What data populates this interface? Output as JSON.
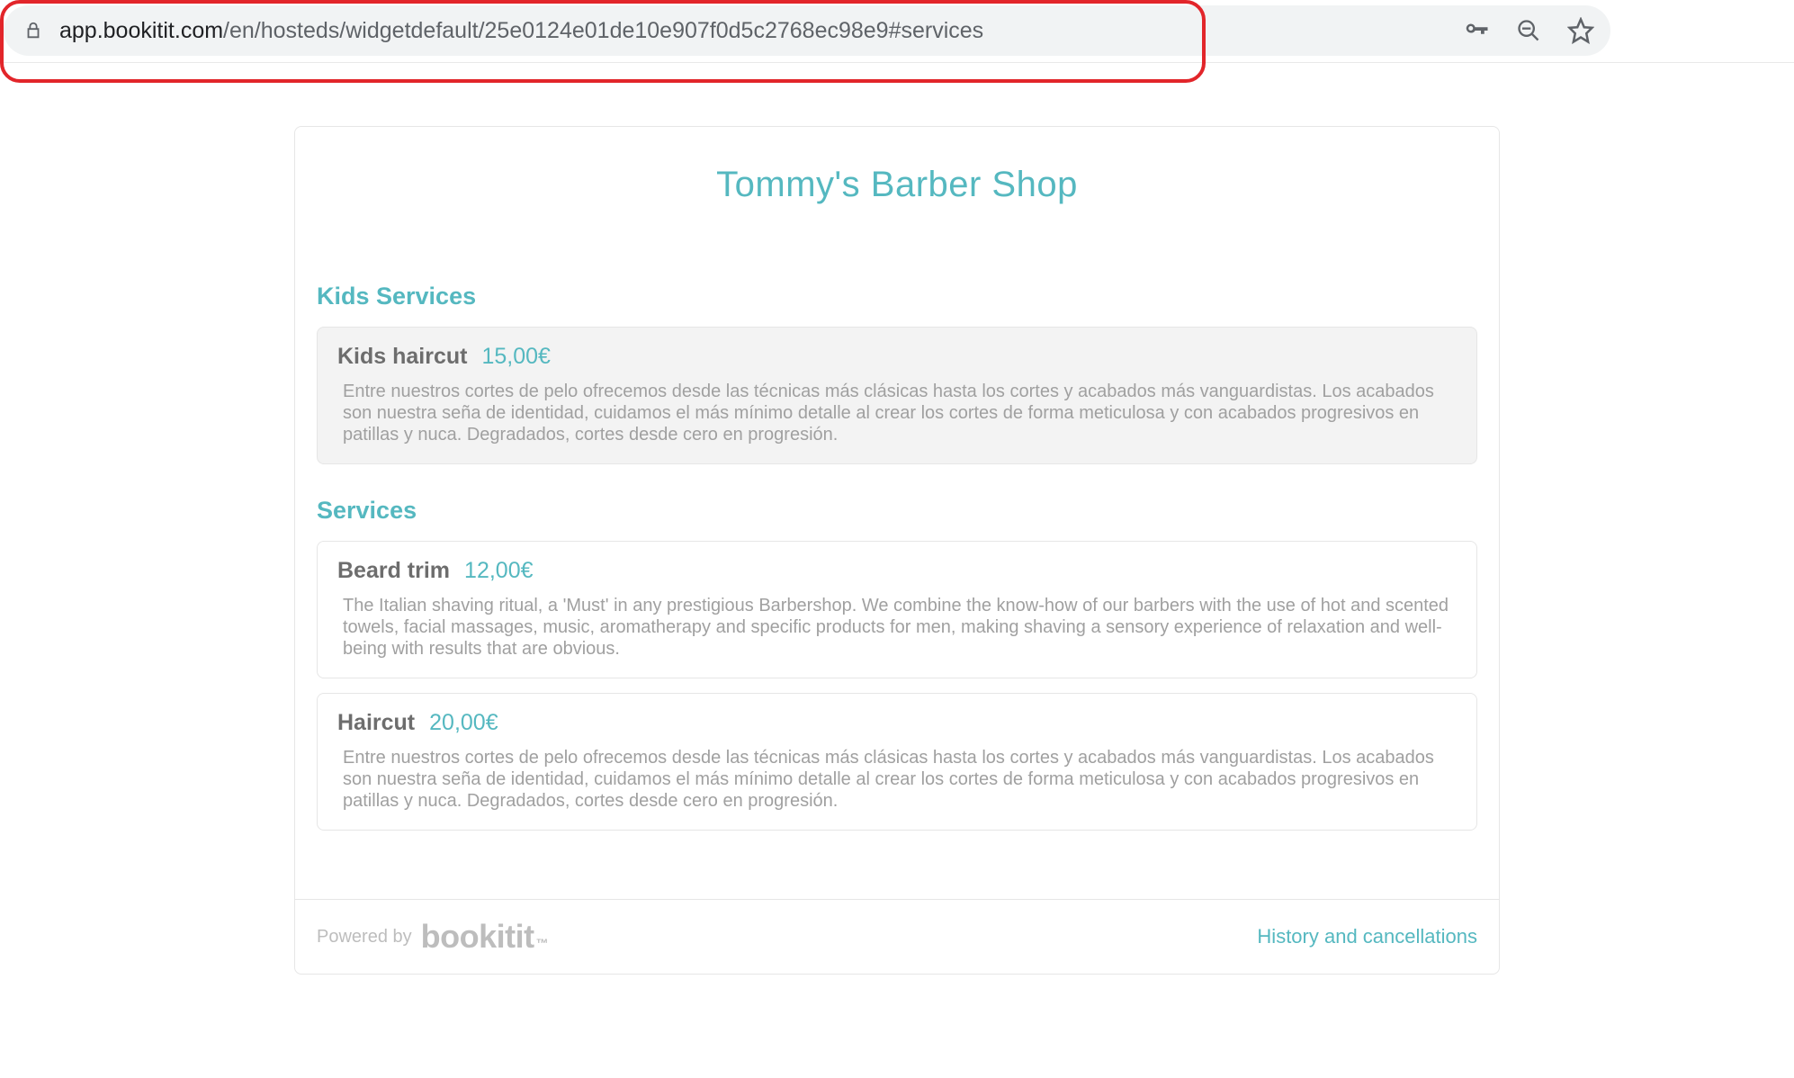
{
  "address_bar": {
    "url_domain": "app.bookitit.com",
    "url_path": "/en/hosteds/widgetdefault/25e0124e01de10e907f0d5c2768ec98e9#services"
  },
  "header": {
    "title": "Tommy's Barber Shop"
  },
  "sections": [
    {
      "title": "Kids Services",
      "services": [
        {
          "name": "Kids haircut",
          "price": "15,00€",
          "selected": true,
          "description": "Entre nuestros cortes de pelo ofrecemos desde las técnicas más clásicas hasta los cortes y acabados más vanguardistas. Los acabados son nuestra seña de identidad, cuidamos el más mínimo detalle al crear los cortes de forma meticulosa y con acabados progresivos en patillas y nuca. Degradados, cortes desde cero en progresión."
        }
      ]
    },
    {
      "title": "Services",
      "services": [
        {
          "name": "Beard trim",
          "price": "12,00€",
          "selected": false,
          "description": "The Italian shaving ritual, a 'Must' in any prestigious Barbershop. We combine the know-how of our barbers with the use of hot and scented towels, facial massages, music, aromatherapy and specific products for men, making shaving a sensory experience of relaxation and well-being with results that are obvious."
        },
        {
          "name": "Haircut",
          "price": "20,00€",
          "selected": false,
          "description": "Entre nuestros cortes de pelo ofrecemos desde las técnicas más clásicas hasta los cortes y acabados más vanguardistas. Los acabados son nuestra seña de identidad, cuidamos el más mínimo detalle al crear los cortes de forma meticulosa y con acabados progresivos en patillas y nuca. Degradados, cortes desde cero en progresión."
        }
      ]
    }
  ],
  "footer": {
    "powered_by_label": "Powered by",
    "brand": "bookitit",
    "history_link": "History and cancellations"
  }
}
